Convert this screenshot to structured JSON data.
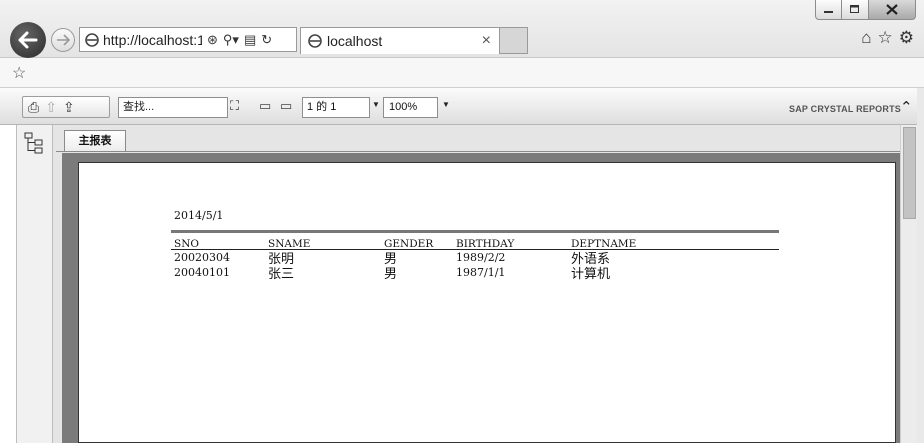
{
  "browser": {
    "address_url": "http://localhost:1",
    "tab_title": "localhost",
    "tab_close": "×"
  },
  "toolbar": {
    "search_placeholder": "查找...",
    "page_indicator": "1 的 1",
    "zoom": "100%",
    "brand": "SAP CRYSTAL REPORTS"
  },
  "report": {
    "tab_label": "主报表",
    "date": "2014/5/1",
    "columns": [
      "SNO",
      "SNAME",
      "GENDER",
      "BIRTHDAY",
      "DEPTNAME"
    ],
    "rows": [
      [
        "20020304",
        "张明",
        "男",
        "1989/2/2",
        "外语系"
      ],
      [
        "20040101",
        "张三",
        "男",
        "1987/1/1",
        "计算机"
      ]
    ]
  }
}
